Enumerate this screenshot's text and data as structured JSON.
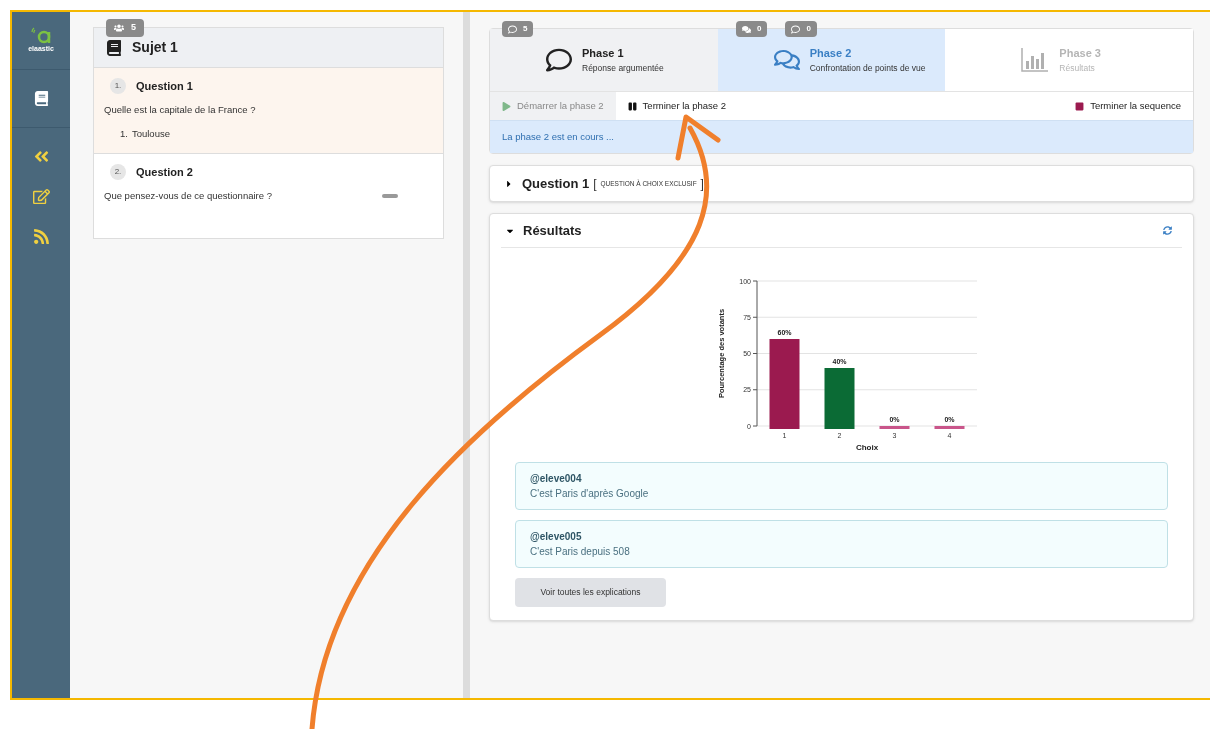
{
  "sidebar": {
    "logo": "elaastic",
    "items": [
      {
        "kind": "book"
      },
      {
        "kind": "collapse"
      },
      {
        "kind": "edit"
      },
      {
        "kind": "feed"
      }
    ]
  },
  "subject": {
    "badge": "5",
    "title": "Sujet 1",
    "questions": [
      {
        "number": "1.",
        "title": "Question 1",
        "text": "Quelle est la capitale de la France ?",
        "selected": true,
        "answers": [
          {
            "number": "1.",
            "text": "Toulouse"
          }
        ]
      },
      {
        "number": "2.",
        "title": "Question 2",
        "text": "Que pensez-vous de ce questionnaire ?",
        "selected": false
      }
    ]
  },
  "phases": [
    {
      "kind": "comment",
      "title": "Phase 1",
      "subtitle": "Réponse argumentée",
      "selected": false,
      "disabled": false,
      "badges": [
        {
          "kind": "comment",
          "count": "5"
        }
      ]
    },
    {
      "kind": "comments",
      "title": "Phase 2",
      "subtitle": "Confrontation de points de vue",
      "selected": true,
      "disabled": false,
      "badges": [
        {
          "kind": "comments",
          "count": "0"
        },
        {
          "kind": "comment",
          "count": "0"
        }
      ]
    },
    {
      "kind": "chart",
      "title": "Phase 3",
      "subtitle": "Résultats",
      "selected": false,
      "disabled": true
    }
  ],
  "controls": [
    {
      "kind": "play",
      "label": "Démarrer la phase 2",
      "disabled": true
    },
    {
      "kind": "pause",
      "label": "Terminer la phase 2",
      "disabled": false
    },
    {
      "kind": "stop",
      "label": "Terminer la sequence",
      "disabled": false
    }
  ],
  "status": "La phase 2 est en cours ...",
  "question_panel": {
    "title": "Question 1",
    "bracket_open": "[",
    "type": "QUESTION À CHOIX EXCLUSIF",
    "bracket_close": "]",
    "expanded": false
  },
  "results": {
    "title": "Résultats",
    "expanded": true,
    "chart_data": {
      "type": "bar",
      "xlabel": "Choix",
      "ylabel": "Pourcentage des votants",
      "categories": [
        "1",
        "2",
        "3",
        "4"
      ],
      "stacked": true,
      "grid": true,
      "series": [
        {
          "color": "#9b1a4f",
          "values": [
            60,
            null,
            null,
            null
          ]
        },
        {
          "color": "#0b6b35",
          "values": [
            null,
            40,
            null,
            null
          ]
        },
        {
          "color": "#c9558a",
          "values": [
            null,
            null,
            0,
            0
          ]
        }
      ],
      "ylim": [
        0,
        100
      ],
      "yticks": [
        0,
        25,
        50,
        75,
        100
      ],
      "value_labels": [
        "60%",
        "40%",
        "0%",
        "0%"
      ]
    },
    "explanations": [
      {
        "author": "@eleve004",
        "text": "C'est Paris d'après Google"
      },
      {
        "author": "@eleve005",
        "text": "C'est Paris depuis 508"
      }
    ],
    "button": "Voir toutes les explications"
  }
}
